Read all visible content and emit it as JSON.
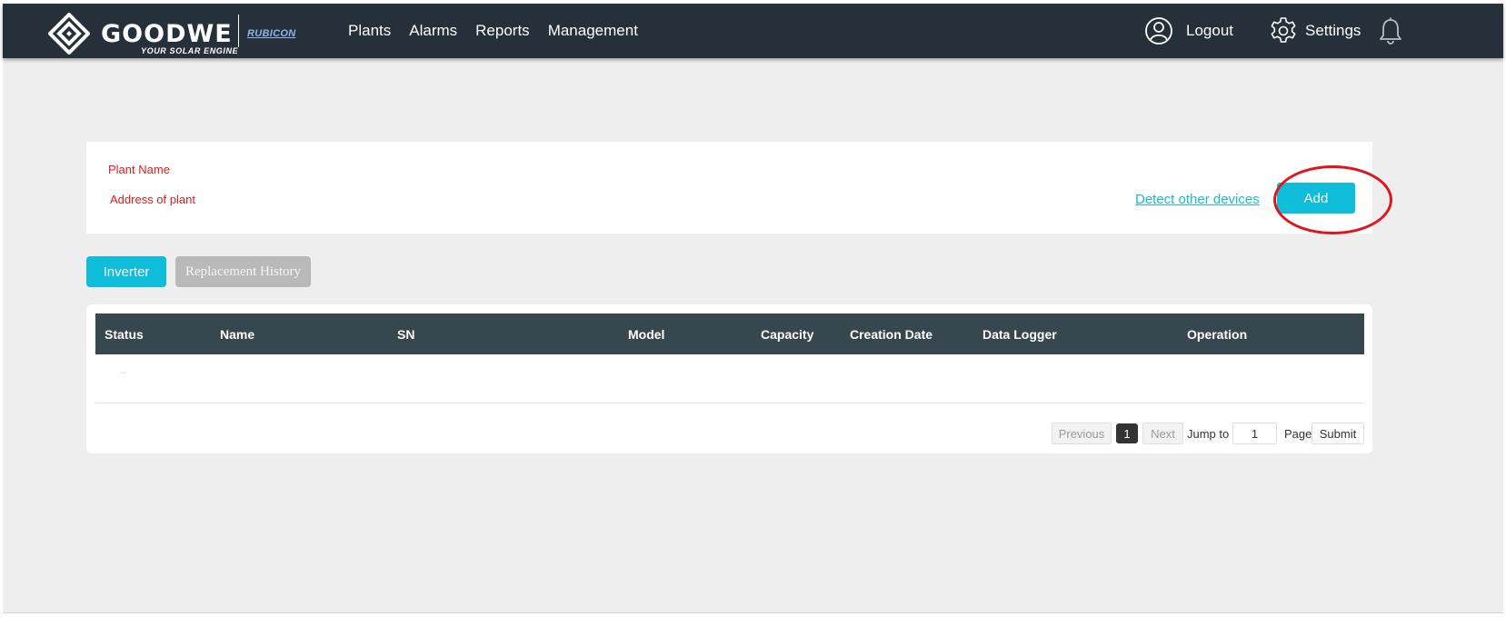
{
  "brand": {
    "name": "GOODWE",
    "tagline": "YOUR SOLAR ENGINE",
    "partner": "RUBICON"
  },
  "nav": {
    "items": [
      "Plants",
      "Alarms",
      "Reports",
      "Management"
    ]
  },
  "header": {
    "logout_label": "Logout",
    "settings_label": "Settings"
  },
  "plant": {
    "name_label": "Plant Name",
    "address_label": "Address of plant",
    "detect_link": "Detect other devices",
    "add_button": "Add"
  },
  "tabs": {
    "inverter": "Inverter",
    "history": "Replacement History"
  },
  "table": {
    "columns": [
      "Status",
      "Name",
      "SN",
      "Model",
      "Capacity",
      "Creation Date",
      "Data Logger",
      "Operation"
    ],
    "empty_marker": "--"
  },
  "pagination": {
    "previous": "Previous",
    "current_page": "1",
    "next": "Next",
    "jump_to": "Jump to",
    "jump_value": "1",
    "page_label": "Page",
    "submit": "Submit"
  },
  "colors": {
    "header_bg": "#25303b",
    "accent": "#0fbcd9",
    "label_red": "#e8191a",
    "annotation": "#e3131b",
    "table_header": "#37474f"
  }
}
